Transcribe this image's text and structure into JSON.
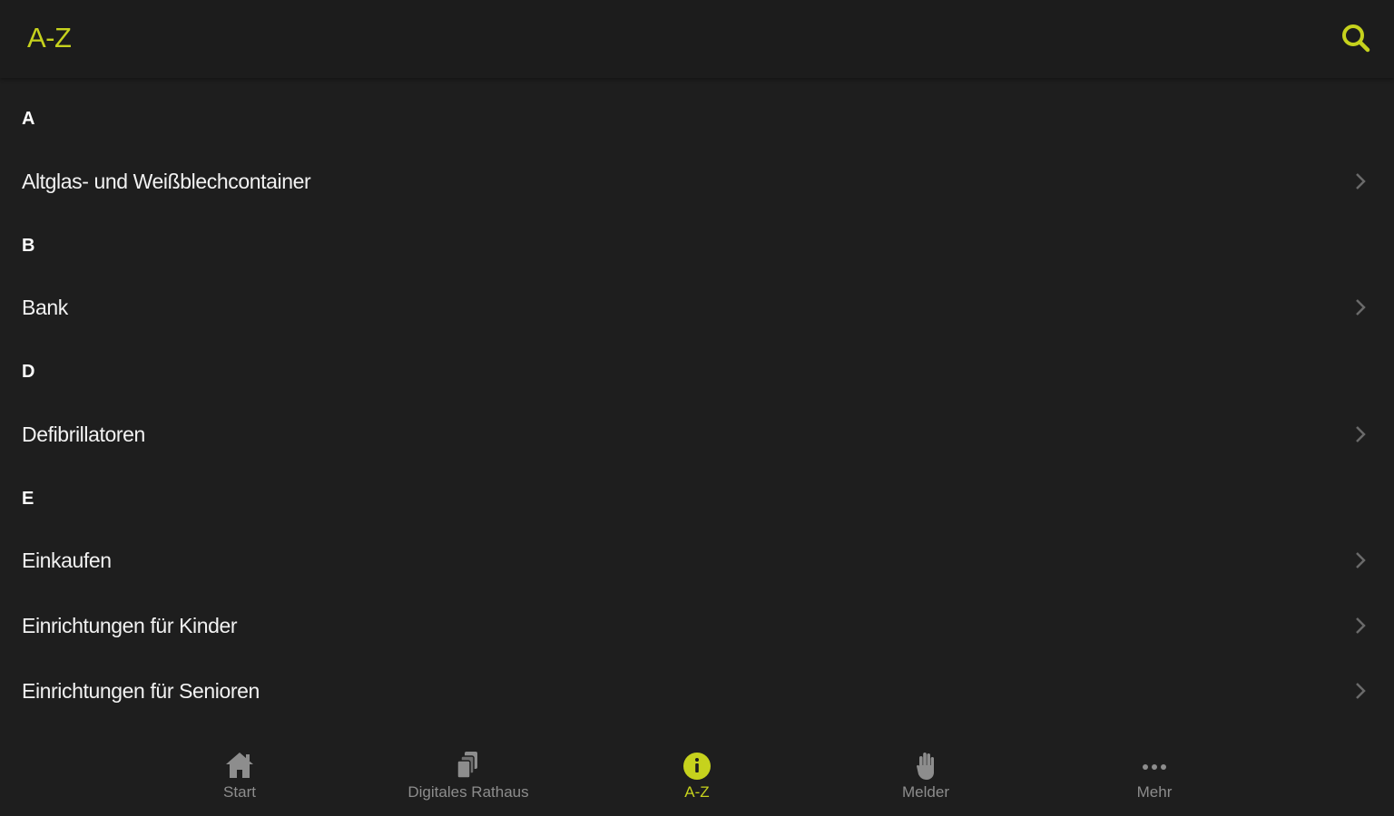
{
  "header": {
    "title": "A-Z",
    "search_icon": "search-icon"
  },
  "colors": {
    "accent": "#c6d21d",
    "background": "#1e1e1e",
    "appbar": "#1c1c1c",
    "inactive": "#8d8d8d"
  },
  "list": {
    "sections": [
      {
        "letter": "A",
        "items": [
          "Altglas- und Weißblechcontainer"
        ]
      },
      {
        "letter": "B",
        "items": [
          "Bank"
        ]
      },
      {
        "letter": "D",
        "items": [
          "Defibrillatoren"
        ]
      },
      {
        "letter": "E",
        "items": [
          "Einkaufen",
          "Einrichtungen für Kinder",
          "Einrichtungen für Senioren"
        ]
      }
    ]
  },
  "bottom_nav": {
    "items": [
      {
        "label": "Start",
        "icon": "home-icon",
        "active": false
      },
      {
        "label": "Digitales Rathaus",
        "icon": "documents-icon",
        "active": false
      },
      {
        "label": "A-Z",
        "icon": "info-circle-icon",
        "active": true
      },
      {
        "label": "Melder",
        "icon": "hand-icon",
        "active": false
      },
      {
        "label": "Mehr",
        "icon": "more-dots-icon",
        "active": false
      }
    ]
  }
}
